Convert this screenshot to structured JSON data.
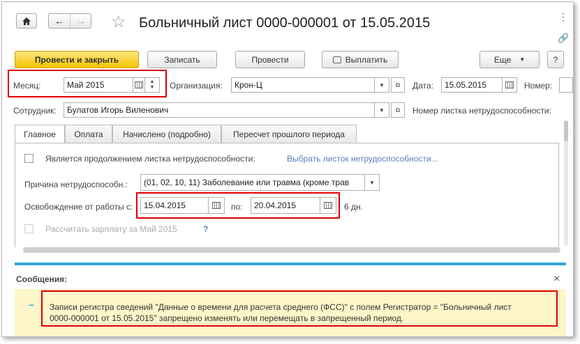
{
  "header": {
    "title": "Больничный лист 0000-000001 от 15.05.2015",
    "home_icon": "home-icon",
    "back_icon": "arrow-left-icon",
    "forward_icon": "arrow-right-icon",
    "star_icon": "star-icon",
    "more_icon": "vertical-ellipsis-icon",
    "link_icon": "link-icon"
  },
  "toolbar": {
    "post_close": "Провести и закрыть",
    "save": "Записать",
    "post": "Провести",
    "pay": "Выплатить",
    "more": "Еще",
    "more_arrow": "▼",
    "help": "?"
  },
  "form": {
    "month_label": "Месяц:",
    "month_value": "Май 2015",
    "org_label": "Организация:",
    "org_value": "Крон-Ц",
    "date_label": "Дата:",
    "date_value": "15.05.2015",
    "number_label": "Номер:",
    "employee_label": "Сотрудник:",
    "employee_value": "Булатов Игорь Виленович",
    "sick_number_label": "Номер листка нетрудоспособности:"
  },
  "tabs": [
    "Главное",
    "Оплата",
    "Начислено (подробно)",
    "Пересчет прошлого периода"
  ],
  "main": {
    "continuation_label": "Является продолжением листка нетрудоспособности:",
    "select_link": "Выбрать листок нетрудоспособности...",
    "reason_label": "Причина нетрудоспособн.:",
    "reason_value": "(01, 02, 10, 11) Заболевание или травма (кроме трав",
    "release_label": "Освобождение от работы с:",
    "from_value": "15.04.2015",
    "to_label": "по:",
    "to_value": "20.04.2015",
    "days": "6 дн.",
    "calc_label": "Рассчитать зарплату за Май 2015",
    "calc_help": "?"
  },
  "messages": {
    "title": "Сообщения:",
    "close": "×",
    "collapse": "–",
    "line1": "Записи регистра сведений \"Данные о времени для расчета среднего (ФСС)\" с полем Регистратор = \"Больничный лист",
    "line2": "0000-000001 от 15.05.2015\" запрещено изменять или перемещать в запрещенный период."
  },
  "colors": {
    "primary": "#f5c400",
    "highlight": "#e00000",
    "link": "#5b7fbd",
    "accent_bar": "#2ea6d8",
    "message_bg": "#fdf6c9"
  }
}
